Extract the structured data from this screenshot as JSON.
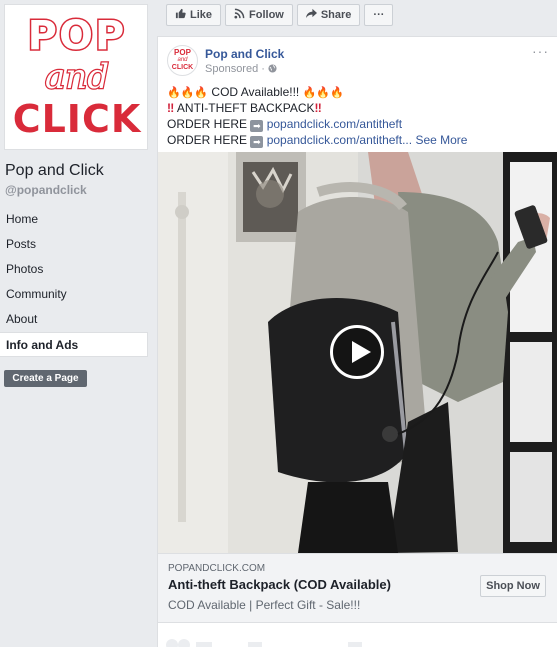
{
  "page": {
    "name": "Pop and Click",
    "handle": "@popandclick",
    "logo": {
      "line1": "POP",
      "line2": "and",
      "line3": "CLICK"
    },
    "brand_color": "#d92b3a"
  },
  "nav": {
    "items": [
      {
        "label": "Home"
      },
      {
        "label": "Posts"
      },
      {
        "label": "Photos"
      },
      {
        "label": "Community"
      },
      {
        "label": "About"
      },
      {
        "label": "Info and Ads",
        "active": true
      }
    ],
    "create_page": "Create a Page"
  },
  "actions": {
    "like": "Like",
    "follow": "Follow",
    "share": "Share",
    "more": "···"
  },
  "post": {
    "author": "Pop and Click",
    "sponsored": "Sponsored · ",
    "line1_text": " COD Available!!! ",
    "line2_text": " ANTI-THEFT BACKPACK",
    "line3_label": "ORDER HERE ",
    "line3_link": "popandclick.com/antitheft",
    "line4_label": "ORDER HERE ",
    "line4_link": "popandclick.com/antitheft...",
    "see_more": "See More",
    "fire": "🔥🔥🔥",
    "bang": "‼",
    "arrow": "➡"
  },
  "cta": {
    "domain": "POPANDCLICK.COM",
    "title": "Anti-theft Backpack (COD Available)",
    "description": "COD Available | Perfect Gift - Sale!!!",
    "button": "Shop Now"
  }
}
